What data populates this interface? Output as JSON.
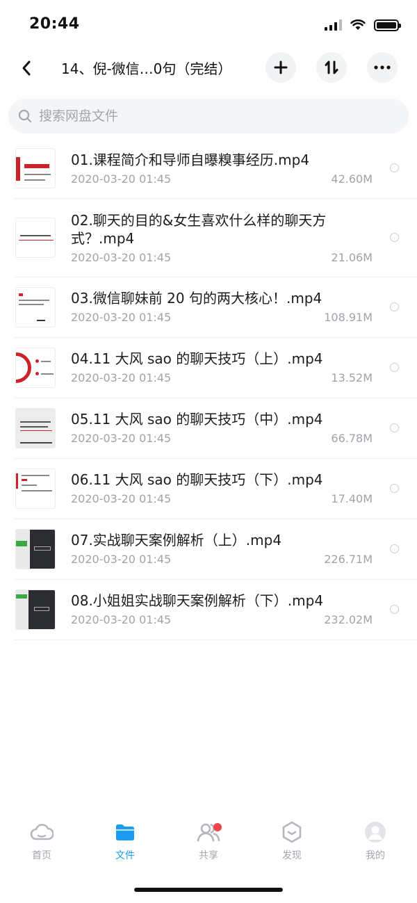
{
  "status_bar": {
    "time": "20:44"
  },
  "header": {
    "title": "14、倪-微信…0句（完结）"
  },
  "search": {
    "placeholder": "搜索网盘文件"
  },
  "files": [
    {
      "name": "01.课程简介和导师自曝糗事经历.mp4",
      "date": "2020-03-20 01:45",
      "size": "42.60M"
    },
    {
      "name": "02.聊天的目的&女生喜欢什么样的聊天方式？.mp4",
      "date": "2020-03-20 01:45",
      "size": "21.06M"
    },
    {
      "name": "03.微信聊妹前 20 句的两大核心！.mp4",
      "date": "2020-03-20 01:45",
      "size": "108.91M"
    },
    {
      "name": "04.11 大风 sao 的聊天技巧（上）.mp4",
      "date": "2020-03-20 01:45",
      "size": "13.52M"
    },
    {
      "name": "05.11 大风 sao 的聊天技巧（中）.mp4",
      "date": "2020-03-20 01:45",
      "size": "66.78M"
    },
    {
      "name": "06.11 大风 sao 的聊天技巧（下）.mp4",
      "date": "2020-03-20 01:45",
      "size": "17.40M"
    },
    {
      "name": "07.实战聊天案例解析（上）.mp4",
      "date": "2020-03-20 01:45",
      "size": "226.71M"
    },
    {
      "name": "08.小姐姐实战聊天案例解析（下）.mp4",
      "date": "2020-03-20 01:45",
      "size": "232.02M"
    }
  ],
  "tabs": [
    {
      "label": "首页",
      "icon": "cloud-icon"
    },
    {
      "label": "文件",
      "icon": "folder-icon",
      "active": true
    },
    {
      "label": "共享",
      "icon": "people-icon"
    },
    {
      "label": "发现",
      "icon": "discover-icon"
    },
    {
      "label": "我的",
      "icon": "avatar-icon"
    }
  ],
  "colors": {
    "accent": "#1a9cf2",
    "badge": "#f0464b",
    "thumb_red": "#c9242b"
  }
}
